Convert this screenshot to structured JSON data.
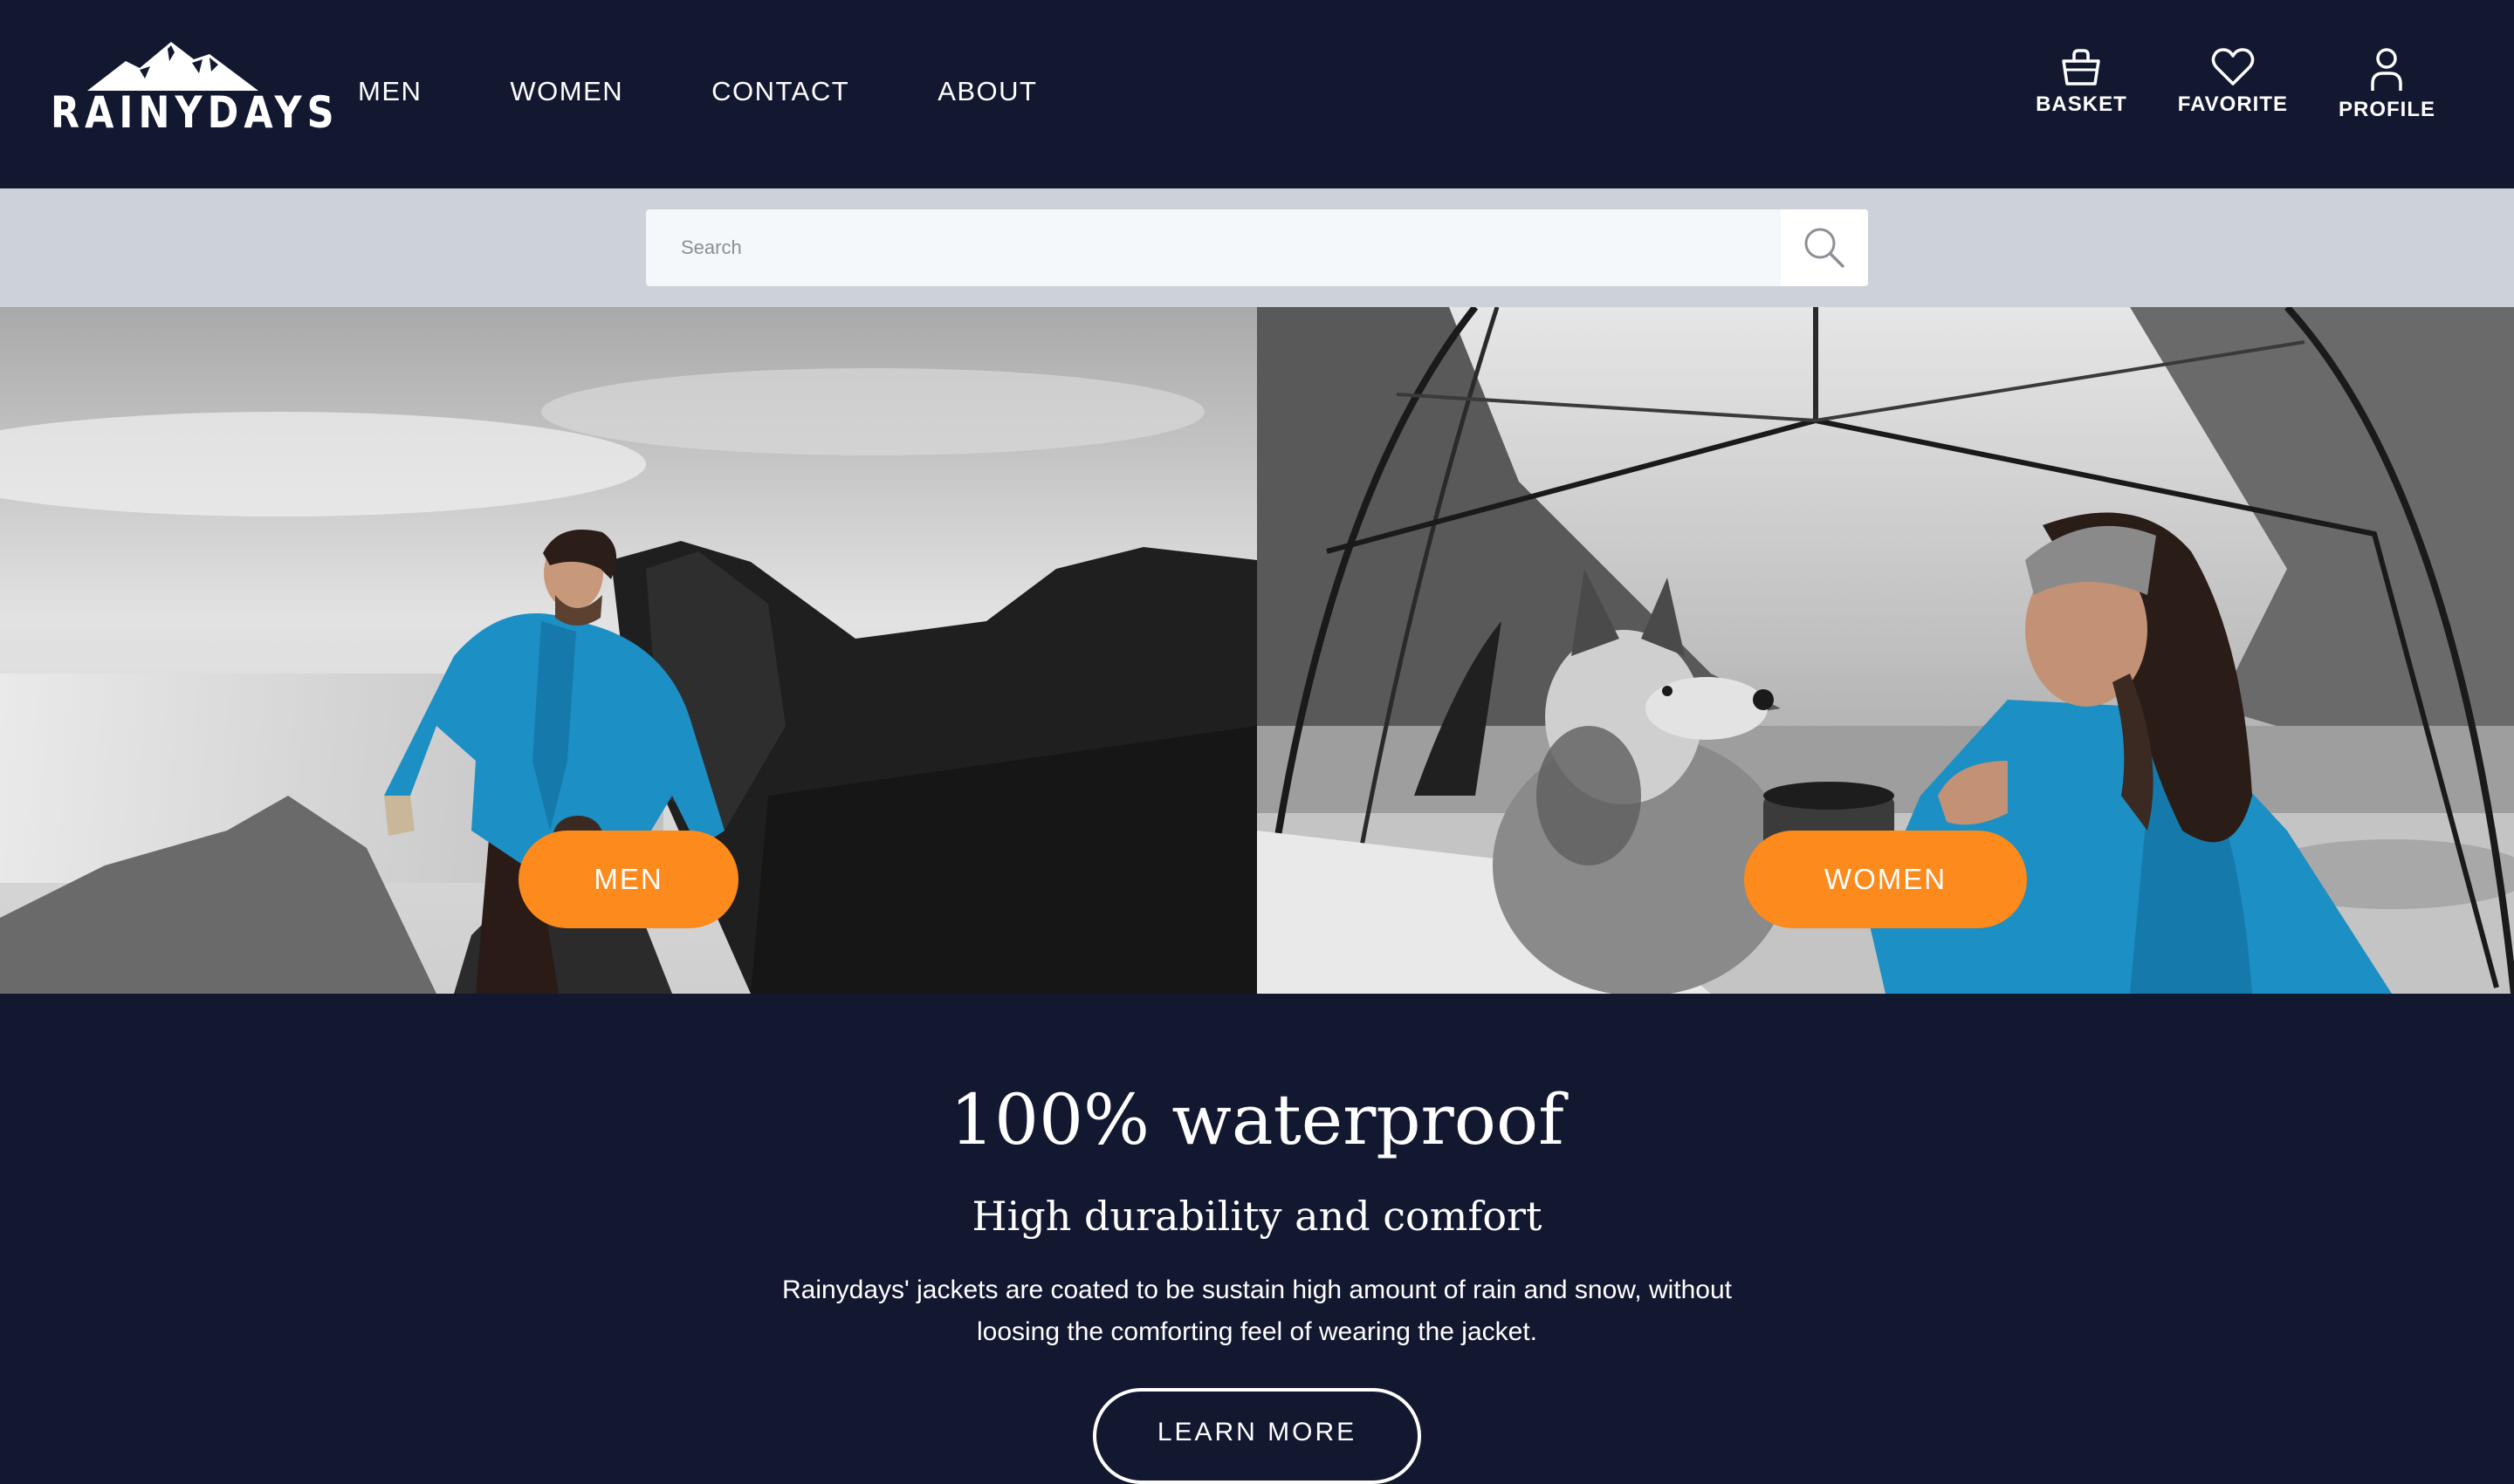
{
  "brand": {
    "name": "RAINYDAYS"
  },
  "nav": {
    "main": [
      "MEN",
      "WOMEN",
      "CONTACT",
      "ABOUT"
    ],
    "basket_label": "BASKET",
    "favorite_label": "FAVORITE",
    "profile_label": "PROFILE"
  },
  "search": {
    "placeholder": "Search"
  },
  "hero": {
    "men_button": "MEN",
    "women_button": "WOMEN"
  },
  "info": {
    "title": "100% waterproof",
    "subtitle": "High durability and comfort",
    "body": "Rainydays' jackets are coated to be sustain high amount of rain and snow, without loosing the comforting feel of wearing the jacket.",
    "cta": "LEARN MORE"
  },
  "colors": {
    "navy": "#131831",
    "search_strip": "#cdd1d9",
    "accent_orange": "#fc8a1c",
    "jacket_blue": "#1c8fc4"
  },
  "icons": [
    "mountain-logo-icon",
    "basket-icon",
    "heart-icon",
    "person-icon",
    "search-icon"
  ]
}
